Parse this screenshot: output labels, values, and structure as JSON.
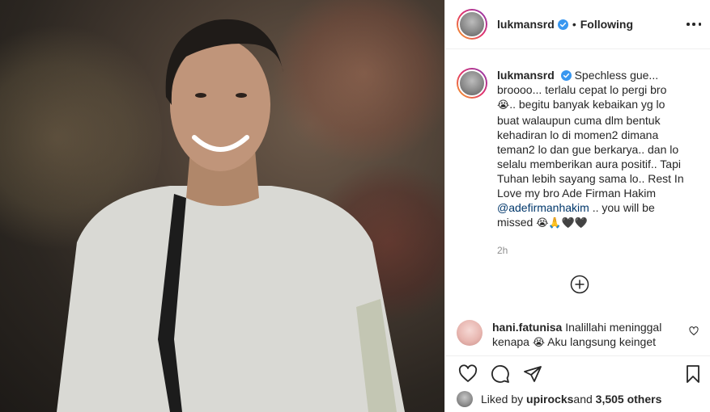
{
  "post": {
    "author": "lukmansrd",
    "follow_state": "Following",
    "separator": "•"
  },
  "caption": {
    "username": "lukmansrd",
    "text_part1": "Spechless gue... broooo... terlalu cepat lo pergi bro ",
    "emoji1": "😭",
    "text_part2": ".. begitu banyak kebaikan yg lo buat walaupun cuma dlm bentuk kehadiran lo di momen2 dimana teman2 lo dan gue berkarya.. dan lo selalu memberikan aura positif.. Tapi Tuhan lebih sayang sama lo.. Rest In Love my bro Ade Firman Hakim ",
    "mention": "@adefirmanhakim",
    "text_part3": " .. you will be missed ",
    "emoji_end": "😭🙏🖤🖤",
    "time": "2h"
  },
  "comment": {
    "username": "hani.fatunisa",
    "text_part1": " Inalillahi meninggal kenapa ",
    "emoji": "😭",
    "text_part2": " Aku langsung keinget"
  },
  "likes": {
    "prefix": "Liked by ",
    "user": "upirocks",
    "middle": " and ",
    "count": "3,505 others"
  },
  "icons": {
    "heart": "heart-icon",
    "comment": "comment-icon",
    "share": "share-icon",
    "save": "bookmark-icon",
    "more": "more-icon",
    "add": "plus-circle-icon"
  },
  "colors": {
    "verified": "#3897f0",
    "mention": "#00376b",
    "muted": "#8e8e8e"
  }
}
